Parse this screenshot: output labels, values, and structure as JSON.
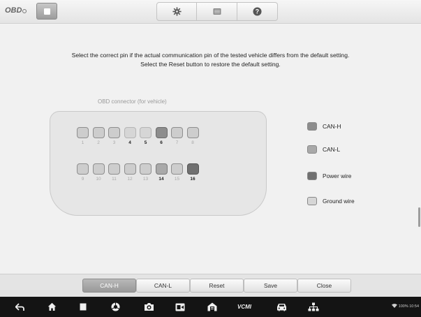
{
  "header": {
    "logo_text": "OBD",
    "stop_icon": "stop-icon",
    "tools": [
      {
        "name": "settings",
        "icon": "gear-icon"
      },
      {
        "name": "files",
        "icon": "folder-icon"
      },
      {
        "name": "help",
        "icon": "help-icon"
      }
    ]
  },
  "instructions": {
    "line1": "Select the correct pin if the actual communication pin of the tested vehicle differs from the default setting.",
    "line2": "Select the Reset button to restore the default setting."
  },
  "connector": {
    "title": "OBD connector (for vehicle)",
    "top_row": [
      {
        "num": "1",
        "role": "none"
      },
      {
        "num": "2",
        "role": "none"
      },
      {
        "num": "3",
        "role": "none"
      },
      {
        "num": "4",
        "role": "ground"
      },
      {
        "num": "5",
        "role": "ground"
      },
      {
        "num": "6",
        "role": "can-h"
      },
      {
        "num": "7",
        "role": "none"
      },
      {
        "num": "8",
        "role": "none"
      }
    ],
    "bottom_row": [
      {
        "num": "9",
        "role": "none"
      },
      {
        "num": "10",
        "role": "none"
      },
      {
        "num": "11",
        "role": "none"
      },
      {
        "num": "12",
        "role": "none"
      },
      {
        "num": "13",
        "role": "none"
      },
      {
        "num": "14",
        "role": "can-l"
      },
      {
        "num": "15",
        "role": "none"
      },
      {
        "num": "16",
        "role": "power"
      }
    ]
  },
  "legend": [
    {
      "label": "CAN-H",
      "color": "#8d8d8d"
    },
    {
      "label": "CAN-L",
      "color": "#a9a9a9"
    },
    {
      "label": "Power wire",
      "color": "#707070"
    },
    {
      "label": "Ground wire",
      "color": "#d6d6d6"
    }
  ],
  "actions": [
    {
      "label": "CAN-H",
      "active": true
    },
    {
      "label": "CAN-L",
      "active": false
    },
    {
      "label": "Reset",
      "active": false
    },
    {
      "label": "Save",
      "active": false
    },
    {
      "label": "Close",
      "active": false
    }
  ],
  "navbar": {
    "icons": [
      "back-icon",
      "home-icon",
      "recent-apps-icon",
      "browser-icon",
      "camera-icon",
      "screen-record-icon",
      "home-garage-icon",
      "vcmi-icon",
      "car-icon",
      "network-icon"
    ],
    "vcmi_text": "VCMI",
    "status_text": "100% 10:54"
  }
}
